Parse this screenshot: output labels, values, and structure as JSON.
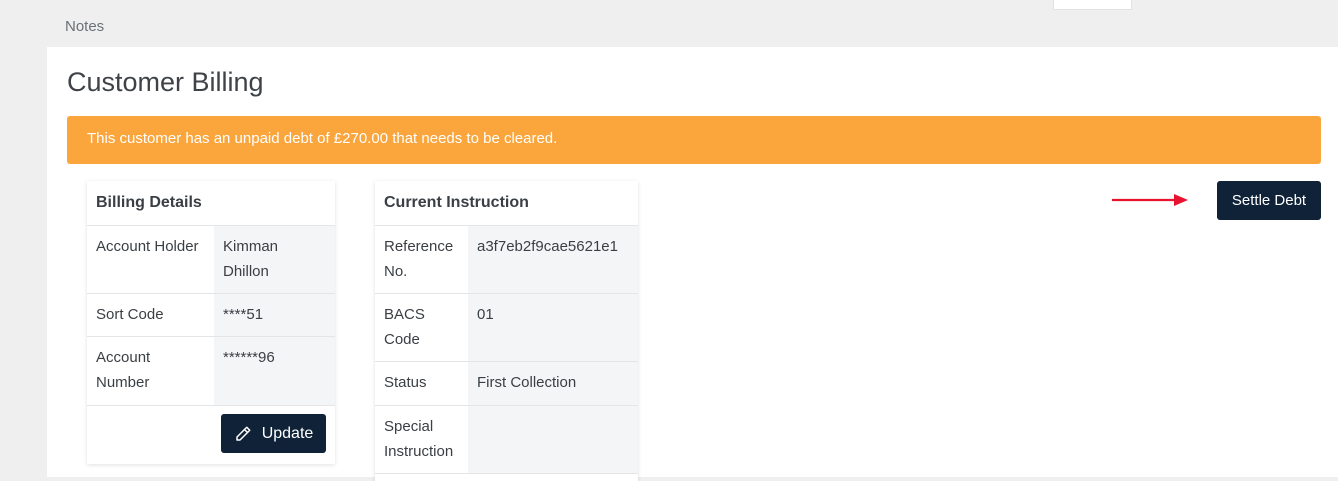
{
  "topbar": {
    "notes_label": "Notes"
  },
  "page": {
    "title": "Customer Billing"
  },
  "alert": {
    "text": "This customer has an unpaid debt of £270.00 that needs to be cleared.",
    "color": "#fba53d"
  },
  "billing": {
    "title": "Billing Details",
    "rows": [
      {
        "label": "Account Holder",
        "value": "Kimman Dhillon"
      },
      {
        "label": "Sort Code",
        "value": "****51"
      },
      {
        "label": "Account Number",
        "value": "******96"
      }
    ],
    "update_label": "Update",
    "update_icon": "pencil-icon"
  },
  "instruction": {
    "title": "Current Instruction",
    "rows": [
      {
        "label": "Reference No.",
        "value": "a3f7eb2f9cae5621e1"
      },
      {
        "label": "BACS Code",
        "value": "01"
      },
      {
        "label": "Status",
        "value": "First Collection"
      },
      {
        "label": "Special Instruction",
        "value": ""
      }
    ]
  },
  "actions": {
    "settle_label": "Settle Debt",
    "arrow_icon": "red-arrow-right-icon",
    "arrow_color": "#e8132e",
    "button_color": "#0f2238"
  }
}
